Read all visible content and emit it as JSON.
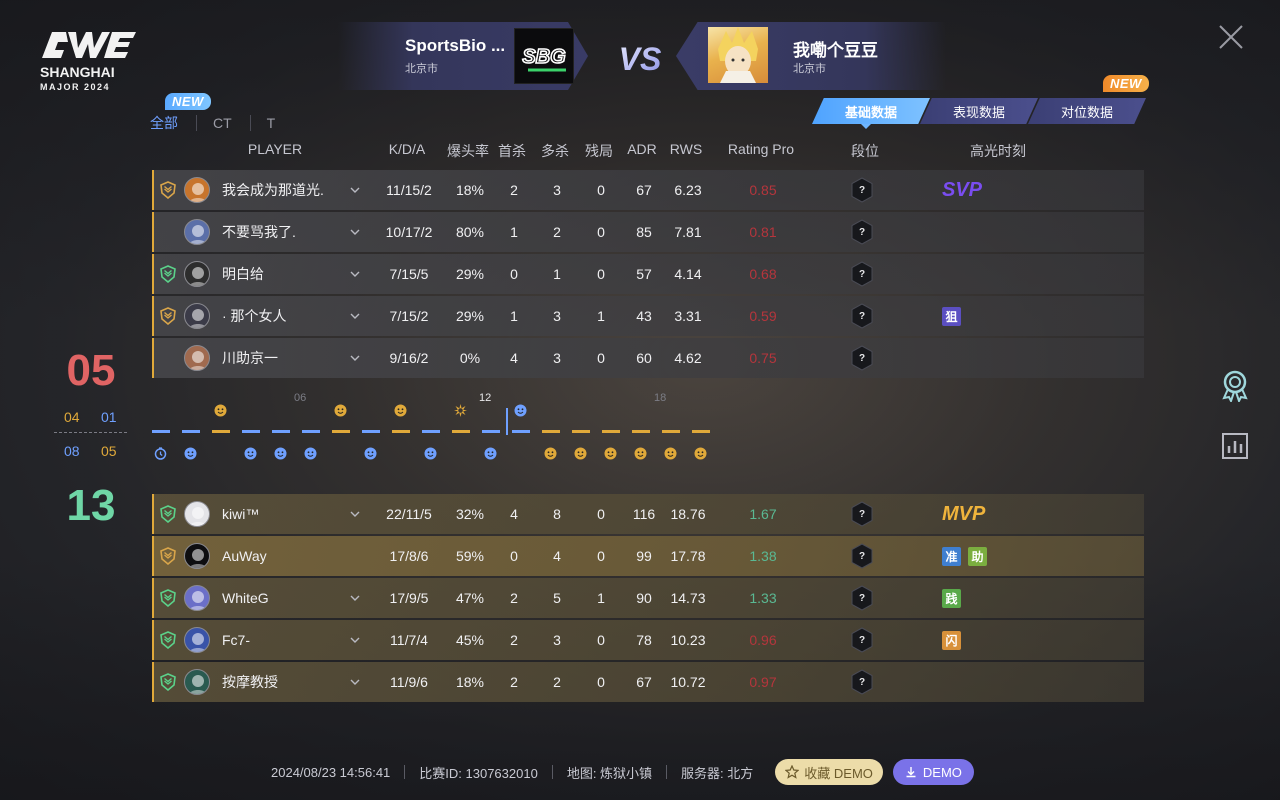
{
  "logo": {
    "line1": "SHANGHAI",
    "line2": "MAJOR 2024"
  },
  "team_a": {
    "name": "SportsBio ...",
    "city": "北京市",
    "logo_text": "SBG"
  },
  "vs_label": "VS",
  "team_b": {
    "name": "我嘞个豆豆",
    "city": "北京市"
  },
  "badges": {
    "new": "NEW"
  },
  "filter_tabs": [
    "全部",
    "CT",
    "T"
  ],
  "view_tabs": [
    "基础数据",
    "表现数据",
    "对位数据"
  ],
  "columns": {
    "player": "PLAYER",
    "kda": "K/D/A",
    "hs": "爆头率",
    "fk": "首杀",
    "mk": "多杀",
    "clutch": "残局",
    "adr": "ADR",
    "rws": "RWS",
    "rating": "Rating Pro",
    "rank": "段位",
    "highlight": "高光时刻"
  },
  "rank_unknown": "?",
  "team_a_players": [
    {
      "name": "我会成为那道光.",
      "kda": "11/15/2",
      "hs": "18%",
      "fk": "2",
      "mk": "3",
      "clutch": "0",
      "adr": "67",
      "rws": "6.23",
      "rating": "0.85",
      "highlight": "SVP",
      "tags": []
    },
    {
      "name": "不要骂我了.",
      "kda": "10/17/2",
      "hs": "80%",
      "fk": "1",
      "mk": "2",
      "clutch": "0",
      "adr": "85",
      "rws": "7.81",
      "rating": "0.81",
      "highlight": "",
      "tags": []
    },
    {
      "name": "明白给",
      "kda": "7/15/5",
      "hs": "29%",
      "fk": "0",
      "mk": "1",
      "clutch": "0",
      "adr": "57",
      "rws": "4.14",
      "rating": "0.68",
      "highlight": "",
      "tags": []
    },
    {
      "name": "· 那个女人",
      "kda": "7/15/2",
      "hs": "29%",
      "fk": "1",
      "mk": "3",
      "clutch": "1",
      "adr": "43",
      "rws": "3.31",
      "rating": "0.59",
      "highlight": "",
      "tags": [
        {
          "text": "狙",
          "color": "#5b4fc2"
        }
      ]
    },
    {
      "name": "川助京一",
      "kda": "9/16/2",
      "hs": "0%",
      "fk": "4",
      "mk": "3",
      "clutch": "0",
      "adr": "60",
      "rws": "4.62",
      "rating": "0.75",
      "highlight": "",
      "tags": []
    }
  ],
  "team_b_players": [
    {
      "name": "kiwi™",
      "kda": "22/11/5",
      "hs": "32%",
      "fk": "4",
      "mk": "8",
      "clutch": "0",
      "adr": "116",
      "rws": "18.76",
      "rating": "1.67",
      "highlight": "MVP",
      "tags": []
    },
    {
      "name": "AuWay",
      "kda": "17/8/6",
      "hs": "59%",
      "fk": "0",
      "mk": "4",
      "clutch": "0",
      "adr": "99",
      "rws": "17.78",
      "rating": "1.38",
      "highlight": "",
      "tags": [
        {
          "text": "准",
          "color": "#3f7fd0"
        },
        {
          "text": "助",
          "color": "#7bae3f"
        }
      ]
    },
    {
      "name": "WhiteG",
      "kda": "17/9/5",
      "hs": "47%",
      "fk": "2",
      "mk": "5",
      "clutch": "1",
      "adr": "90",
      "rws": "14.73",
      "rating": "1.33",
      "highlight": "",
      "tags": [
        {
          "text": "践",
          "color": "#5aa94a"
        }
      ]
    },
    {
      "name": "Fc7-",
      "kda": "11/7/4",
      "hs": "45%",
      "fk": "2",
      "mk": "3",
      "clutch": "0",
      "adr": "78",
      "rws": "10.23",
      "rating": "0.96",
      "highlight": "",
      "tags": [
        {
          "text": "闪",
          "color": "#d8913a"
        }
      ]
    },
    {
      "name": "按摩教授",
      "kda": "11/9/6",
      "hs": "18%",
      "fk": "2",
      "mk": "2",
      "clutch": "0",
      "adr": "67",
      "rws": "10.72",
      "rating": "0.97",
      "highlight": "",
      "tags": []
    }
  ],
  "score": {
    "team_a_total": "05",
    "team_b_total": "13",
    "team_a_half1": "04",
    "team_a_half2": "01",
    "team_b_half1": "08",
    "team_b_half2": "05"
  },
  "timeline": {
    "ticks": [
      "06",
      "12",
      "18"
    ],
    "rounds": [
      "B",
      "B",
      "A",
      "B",
      "B",
      "B",
      "A",
      "B",
      "A",
      "B",
      "A",
      "B",
      "B",
      "A",
      "A",
      "A",
      "A",
      "A",
      "A"
    ]
  },
  "footer": {
    "datetime": "2024/08/23 14:56:41",
    "match_id": "比赛ID: 1307632010",
    "map": "地图: 炼狱小镇",
    "server": "服务器: 北方",
    "fav_label": "收藏 DEMO",
    "demo_label": "DEMO"
  },
  "colors": {
    "accent_blue": "#6fa0ff",
    "team_a_gold": "#e0a93a",
    "rating_bad": "#b5353c",
    "rating_good": "#5ab993",
    "score_red": "#e06464",
    "score_green": "#6fd6a6"
  }
}
